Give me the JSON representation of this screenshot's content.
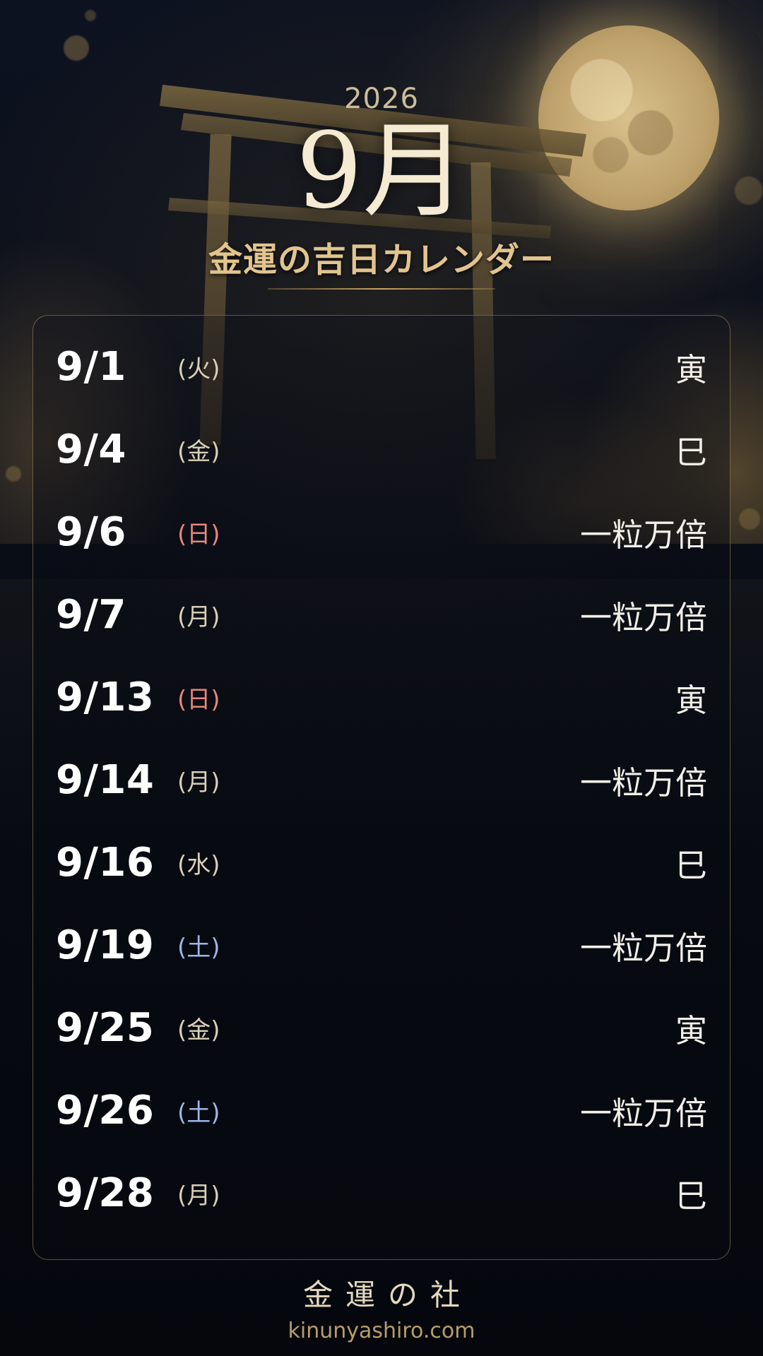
{
  "header": {
    "year": "2026",
    "month": "9月",
    "subtitle": "金運の吉日カレンダー"
  },
  "days": [
    {
      "date": "9/1",
      "dow": "(火)",
      "dow_type": "weekday",
      "label": "寅"
    },
    {
      "date": "9/4",
      "dow": "(金)",
      "dow_type": "weekday",
      "label": "巳"
    },
    {
      "date": "9/6",
      "dow": "(日)",
      "dow_type": "sunday",
      "label": "一粒万倍"
    },
    {
      "date": "9/7",
      "dow": "(月)",
      "dow_type": "weekday",
      "label": "一粒万倍"
    },
    {
      "date": "9/13",
      "dow": "(日)",
      "dow_type": "sunday",
      "label": "寅"
    },
    {
      "date": "9/14",
      "dow": "(月)",
      "dow_type": "weekday",
      "label": "一粒万倍"
    },
    {
      "date": "9/16",
      "dow": "(水)",
      "dow_type": "weekday",
      "label": "巳"
    },
    {
      "date": "9/19",
      "dow": "(土)",
      "dow_type": "saturday",
      "label": "一粒万倍"
    },
    {
      "date": "9/25",
      "dow": "(金)",
      "dow_type": "weekday",
      "label": "寅"
    },
    {
      "date": "9/26",
      "dow": "(土)",
      "dow_type": "saturday",
      "label": "一粒万倍"
    },
    {
      "date": "9/28",
      "dow": "(月)",
      "dow_type": "weekday",
      "label": "巳"
    }
  ],
  "footer": {
    "title": "金運の社",
    "url": "kinunyashiro.com"
  },
  "colors": {
    "accent_gold": "#e2c48e",
    "sunday": "#e8867b",
    "saturday": "#9db6e8"
  }
}
